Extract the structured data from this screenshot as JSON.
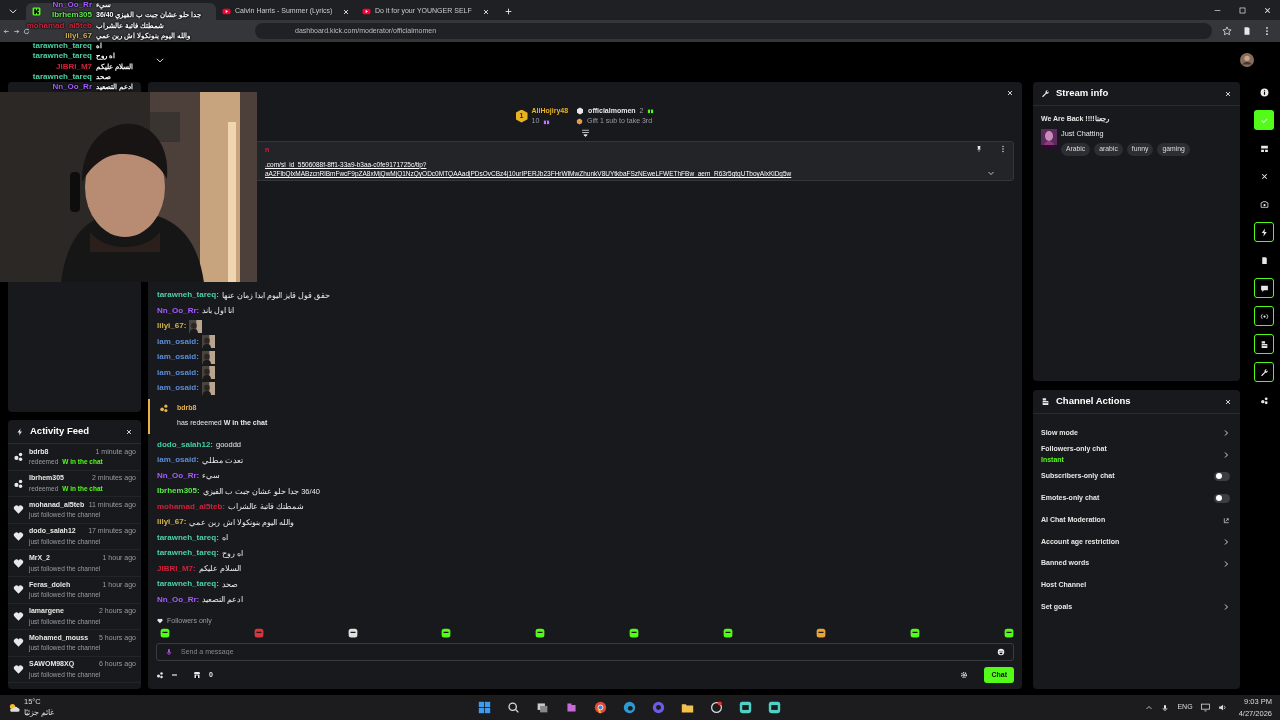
{
  "browser": {
    "tabs": [
      {
        "selected": true
      },
      {
        "title": "Calvin Harris - Summer (Lyrics)",
        "selected": false
      },
      {
        "title": "Do it for your YOUNGER SELF",
        "selected": false
      }
    ],
    "url": "dashboard.kick.com/moderator/officialmomen"
  },
  "overlay_chat": [
    {
      "user": "Nn_Oo_Rr",
      "color": "#a35cff",
      "text": "سيء"
    },
    {
      "user": "Ibrhem305",
      "color": "#5be84a",
      "text": "36/40 جدا حلو عشان جبت ب الفيزي"
    },
    {
      "user": "mohamad_al5teb",
      "color": "#d0213c",
      "text": "شمطتك فاتبة عالشراب"
    },
    {
      "user": "lilyi_67",
      "color": "#d6b24c",
      "text": "والله اليوم بنونكولا اش ربن عمي"
    },
    {
      "user": "tarawneh_tareq",
      "color": "#4fd1a5",
      "text": "اه"
    },
    {
      "user": "tarawneh_tareq",
      "color": "#4fd1a5",
      "text": "اه روح"
    },
    {
      "user": "JIBRI_M7",
      "color": "#d0213c",
      "text": "السلام عليكم"
    },
    {
      "user": "tarawneh_tareq",
      "color": "#4fd1a5",
      "text": "صحد"
    },
    {
      "user": "Nn_Oo_Rr",
      "color": "#a35cff",
      "text": "ادعم التصعيد"
    }
  ],
  "activity_feed": {
    "title": "Activity Feed",
    "items": [
      {
        "kind": "redeem",
        "user": "bdrb8",
        "time": "1 minute ago",
        "action": "redeemed",
        "reward": "W in the chat"
      },
      {
        "kind": "redeem",
        "user": "Ibrhem305",
        "time": "2 minutes ago",
        "action": "redeemed",
        "reward": "W in the chat"
      },
      {
        "kind": "follow",
        "user": "mohanad_al5teb",
        "time": "11 minutes ago",
        "action": "just followed the channel"
      },
      {
        "kind": "follow",
        "user": "dodo_salah12",
        "time": "17 minutes ago",
        "action": "just followed the channel"
      },
      {
        "kind": "follow",
        "user": "MrX_2",
        "time": "1 hour ago",
        "action": "just followed the channel"
      },
      {
        "kind": "follow",
        "user": "Feras_doleh",
        "time": "1 hour ago",
        "action": "just followed the channel"
      },
      {
        "kind": "follow",
        "user": "lamargene",
        "time": "2 hours ago",
        "action": "just followed the channel"
      },
      {
        "kind": "follow",
        "user": "Mohamed_mouss",
        "time": "5 hours ago",
        "action": "just followed the channel"
      },
      {
        "kind": "follow",
        "user": "SAWOM98XQ",
        "time": "6 hours ago",
        "action": "just followed the channel"
      }
    ]
  },
  "chat": {
    "leaderboard": [
      {
        "rank": "1",
        "name": "AliHojiry48",
        "count": "10"
      },
      {
        "name": "officialmomen",
        "count": "2",
        "hint": "Gift 1 sub to take 3rd"
      }
    ],
    "pinned": {
      "author": "n",
      "lines": [
        ".com/sl_id_5506088f-8ff1-33a9-b3aa-c0fe9171725c/tip?",
        "aA2FlbQlxMABzcnRlBmFwcF9pZA8xMjQwMjQ1NzQyODc0MTQAAadjPDsOvCBz4j10urIPERJb23FHrWlMwZhunkV8UYtkbaFSzNEweLFWEThFBw_aem_R63r5gtgUTboyAlxKiDg5w"
      ]
    },
    "messages": [
      {
        "kind": "text",
        "user": "tarawneh_tareq:",
        "color": "#4fd1a5",
        "text": "حقق قول قايز اليوم ابدا زمان عنها"
      },
      {
        "kind": "text",
        "user": "Nn_Oo_Rr:",
        "color": "#a35cff",
        "text": "انا اول باند"
      },
      {
        "kind": "emote",
        "user": "lilyi_67:",
        "color": "#d6b24c"
      },
      {
        "kind": "emote",
        "user": "iam_osaid:",
        "color": "#5b8ddb"
      },
      {
        "kind": "emote",
        "user": "iam_osaid:",
        "color": "#5b8ddb"
      },
      {
        "kind": "emote",
        "user": "iam_osaid:",
        "color": "#5b8ddb"
      },
      {
        "kind": "emote",
        "user": "iam_osaid:",
        "color": "#5b8ddb"
      },
      {
        "kind": "redeem",
        "user": "bdrb8",
        "color": "#e8b14a",
        "text": "has redeemed **W in the chat**"
      },
      {
        "kind": "text",
        "user": "dodo_salah12:",
        "color": "#3fd0a0",
        "text": "gooddd"
      },
      {
        "kind": "text",
        "user": "iam_osaid:",
        "color": "#5b8ddb",
        "text": "تعدت مطلي"
      },
      {
        "kind": "text",
        "user": "Nn_Oo_Rr:",
        "color": "#a35cff",
        "text": "سيء"
      },
      {
        "kind": "text",
        "user": "Ibrhem305:",
        "color": "#5be84a",
        "text": "36/40 جدا حلو عشان جبت ب الفيزي"
      },
      {
        "kind": "text",
        "user": "mohamad_al5teb:",
        "color": "#d0213c",
        "text": "شمطتك فاتبة عالشراب"
      },
      {
        "kind": "text",
        "user": "lilyi_67:",
        "color": "#d6b24c",
        "text": "والله اليوم بنونكولا اش ربن عمي"
      },
      {
        "kind": "text",
        "user": "tarawneh_tareq:",
        "color": "#4fd1a5",
        "text": "اه"
      },
      {
        "kind": "text",
        "user": "tarawneh_tareq:",
        "color": "#4fd1a5",
        "text": "اه روح"
      },
      {
        "kind": "text",
        "user": "JIBRI_M7:",
        "color": "#d0213c",
        "text": "السلام عليكم"
      },
      {
        "kind": "text",
        "user": "tarawneh_tareq:",
        "color": "#4fd1a5",
        "text": "صحد"
      },
      {
        "kind": "text",
        "user": "Nn_Oo_Rr:",
        "color": "#a35cff",
        "text": "ادعم التصعيد"
      }
    ],
    "mode": "Followers only",
    "emotes": [
      {
        "color": "#53fc18"
      },
      {
        "color": "#d8363b"
      },
      {
        "color": "#e0e0e0"
      },
      {
        "color": "#53fc18"
      },
      {
        "color": "#53fc18"
      },
      {
        "color": "#53fc18"
      },
      {
        "color": "#53fc18"
      },
      {
        "color": "#e8a33a"
      },
      {
        "color": "#53fc18"
      },
      {
        "color": "#53fc18"
      }
    ],
    "input": {
      "placeholder": "Send a message"
    },
    "points": "∞",
    "store_count": "0",
    "send_button": "Chat"
  },
  "stream_info": {
    "title": "Stream info",
    "stream_title": "We Are Back !!!!رجعنا",
    "category": "Just Chatting",
    "tags": [
      "Arabic",
      "arabic",
      "funny",
      "gaming"
    ]
  },
  "channel_actions": {
    "title": "Channel Actions",
    "items": [
      {
        "kind": "link",
        "label": "Slow mode"
      },
      {
        "kind": "link",
        "label": "Followers-only chat",
        "value": "Instant"
      },
      {
        "kind": "toggle",
        "label": "Subscribers-only chat",
        "on": false
      },
      {
        "kind": "toggle",
        "label": "Emotes-only chat",
        "on": false
      },
      {
        "kind": "external",
        "label": "AI Chat Moderation"
      },
      {
        "kind": "link",
        "label": "Account age restriction"
      },
      {
        "kind": "link",
        "label": "Banned words"
      },
      {
        "kind": "plain",
        "label": "Host Channel"
      },
      {
        "kind": "link",
        "label": "Set goals"
      }
    ]
  },
  "rail": [
    {
      "kind": "plain"
    },
    {
      "kind": "filled"
    },
    {
      "kind": "plain"
    },
    {
      "kind": "plain"
    },
    {
      "kind": "plain"
    },
    {
      "kind": "outlined"
    },
    {
      "kind": "plain"
    },
    {
      "kind": "outlined"
    },
    {
      "kind": "outlined"
    },
    {
      "kind": "outlined"
    },
    {
      "kind": "outlined"
    },
    {
      "kind": "plain"
    }
  ],
  "taskbar": {
    "temperature": "15°C",
    "condition": "غائم جزئيًا",
    "language": "ENG",
    "time": "9:03 PM",
    "date": "4/27/2026"
  }
}
